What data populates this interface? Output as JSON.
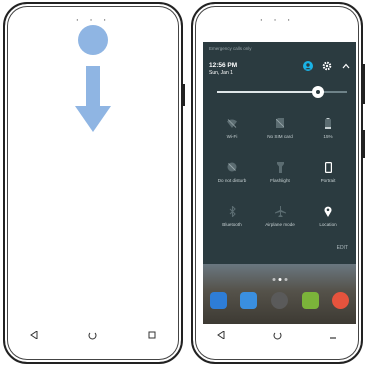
{
  "left_screen": {
    "gesture": "swipe-down"
  },
  "right_screen": {
    "emergency_notice": "Emergency calls only",
    "time": "12:56 PM",
    "date": "Sun, Jan 1",
    "brightness_level": 0.78,
    "tiles": [
      {
        "label": "Wi-Fi",
        "icon": "wifi-icon"
      },
      {
        "label": "No SIM card",
        "icon": "no-sim-icon"
      },
      {
        "label": "15%",
        "icon": "battery-icon"
      },
      {
        "label": "Do not disturb",
        "icon": "do-not-disturb-icon"
      },
      {
        "label": "Flashlight",
        "icon": "flashlight-icon"
      },
      {
        "label": "Portrait",
        "icon": "portrait-icon"
      },
      {
        "label": "Bluetooth",
        "icon": "bluetooth-icon"
      },
      {
        "label": "Airplane mode",
        "icon": "airplane-icon"
      },
      {
        "label": "Location",
        "icon": "location-icon"
      }
    ],
    "edit_label": "EDIT"
  },
  "colors": {
    "accent": "#1ab3e6",
    "panel_bg": "#2b3b40",
    "gesture_blue": "#8fb5e3"
  }
}
